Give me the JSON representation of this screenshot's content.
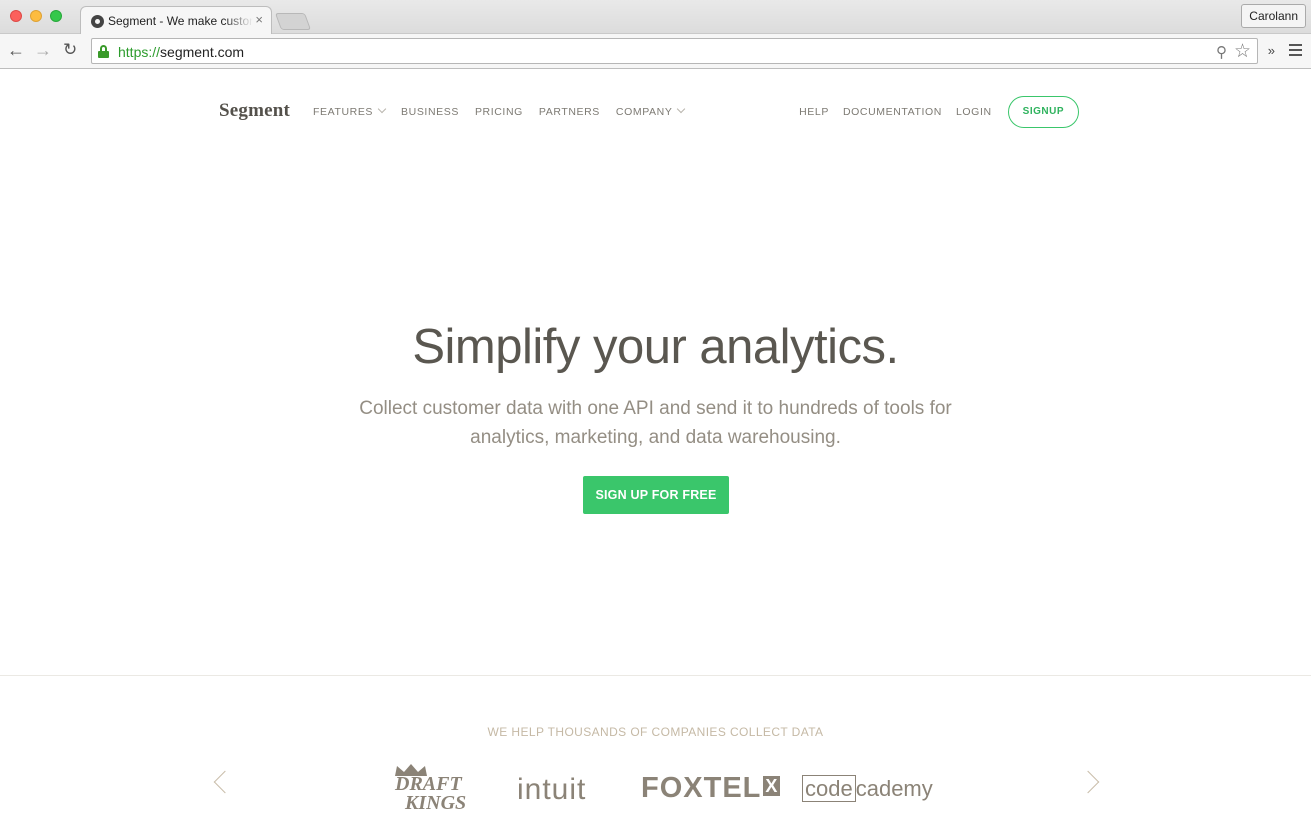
{
  "browser": {
    "tab_title": "Segment - We make customer data simple",
    "tab_close": "×",
    "profile_name": "Carolann",
    "url_scheme": "https://",
    "url_host": "segment.com",
    "back_icon": "←",
    "forward_icon": "→",
    "reload_icon": "↻",
    "zoom_icon": "⚲",
    "star_icon": "☆",
    "extensions_icon": "»"
  },
  "nav": {
    "logo": "Segment",
    "left_items": [
      "FEATURES",
      "BUSINESS",
      "PRICING",
      "PARTNERS",
      "COMPANY"
    ],
    "right_items": [
      "HELP",
      "DOCUMENTATION",
      "LOGIN"
    ],
    "signup_label": "SIGNUP"
  },
  "hero": {
    "title": "Simplify your analytics.",
    "subtitle": "Collect customer data with one API and send it to hundreds of tools for analytics, marketing, and data warehousing.",
    "cta_label": "SIGN UP FOR FREE"
  },
  "customers": {
    "heading": "WE HELP THOUSANDS OF COMPANIES COLLECT DATA",
    "logos": {
      "draftkings_line1": "DRAFT",
      "draftkings_line2": "KINGS",
      "intuit": "intuit",
      "foxtel": "FOXTEL",
      "foxtel_mark": "X",
      "codecademy_box": "code",
      "codecademy_rest": "cademy"
    }
  },
  "colors": {
    "accent_green": "#3ac66b",
    "text_dark": "#5a5750",
    "text_muted": "#948e84",
    "logo_gray": "#8b8377"
  }
}
